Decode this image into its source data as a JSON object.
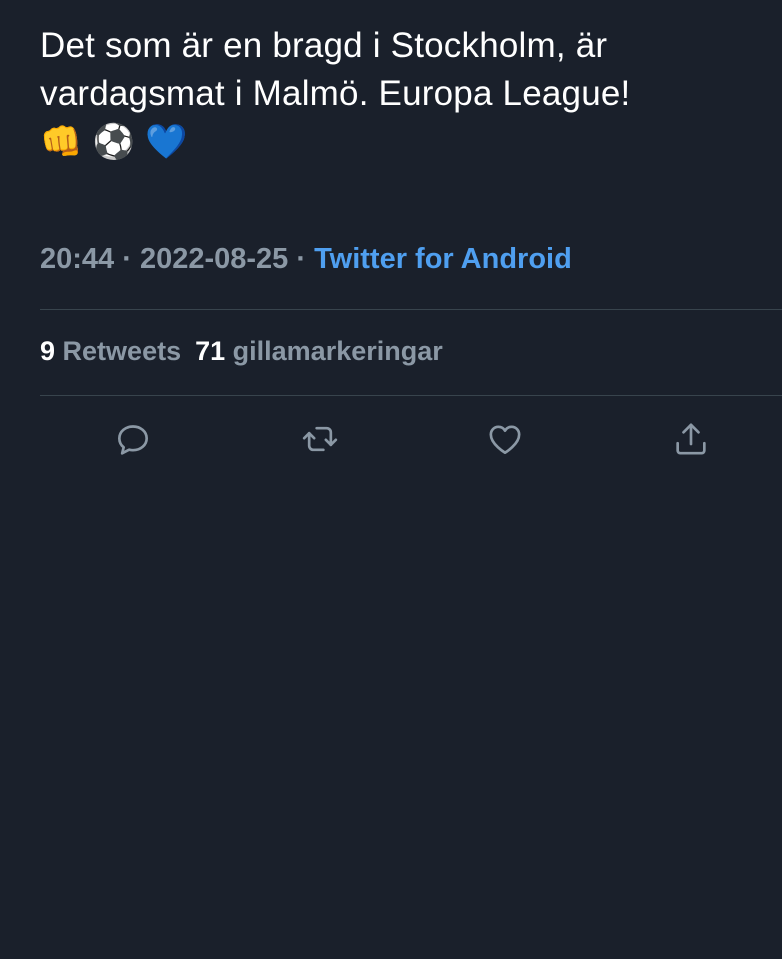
{
  "tweet": {
    "text_lines": [
      "Det som är en bragd i Stockholm, är",
      "vardagsmat i Malmö. Europa League!"
    ],
    "emojis": [
      "👊",
      "⚽",
      "💙"
    ]
  },
  "meta": {
    "time": "20:44",
    "separator": " · ",
    "date": "2022-08-25",
    "source": "Twitter for Android"
  },
  "stats": {
    "retweets_count": "9",
    "retweets_label": "Retweets",
    "likes_count": "71",
    "likes_label": "gillamarkeringar"
  },
  "actions": [
    {
      "icon": "reply-icon"
    },
    {
      "icon": "retweet-icon"
    },
    {
      "icon": "like-icon"
    },
    {
      "icon": "share-icon"
    }
  ],
  "colors": {
    "background": "#1a202b",
    "text": "#ffffff",
    "muted": "#8b98a5",
    "link": "#4f9ff0",
    "divider": "#38444d"
  }
}
